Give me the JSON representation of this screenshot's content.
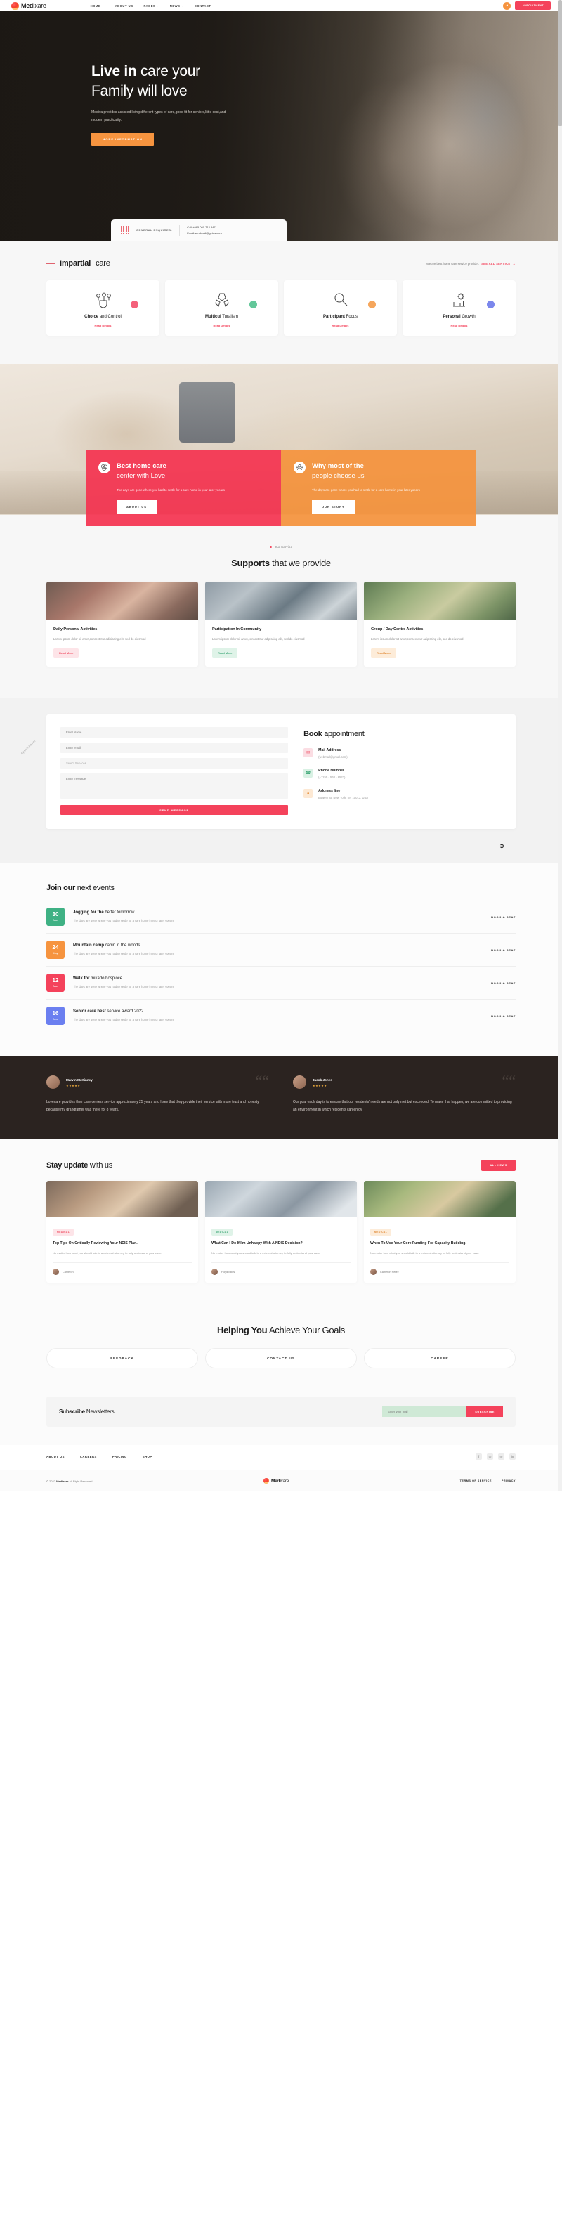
{
  "header": {
    "brand_bold": "Medi",
    "brand_light": "xare",
    "nav": [
      {
        "label": "HOME",
        "caret": "⌄"
      },
      {
        "label": "ABOUT US",
        "caret": ""
      },
      {
        "label": "PAGES",
        "caret": "⌄"
      },
      {
        "label": "NEWS",
        "caret": "⌄"
      },
      {
        "label": "CONTACT",
        "caret": ""
      }
    ],
    "avatar_icon": "user-icon",
    "appointment_label": "APPOINTMENT"
  },
  "hero": {
    "title_line1_bold": "Live in",
    "title_line1_rest": " care your",
    "title_line2": "Family will love",
    "paragraph": "Mediva provides assisted living,different types of care,good fit for seniors,little cost,and modern practicality.",
    "cta_label": "MORE INFORMATION",
    "contact": {
      "icon": "dot-grid-icon",
      "label": "GENERAL ENQUIRES:",
      "phone": "Call:+985 060 712 347",
      "email": "Email:sendmail@getus.com"
    }
  },
  "impartial": {
    "title_bold": "Impartial",
    "title_light": " care",
    "right_text": "We are best home care service provider.",
    "right_link": "SEE ALL SERVICE",
    "right_arrow": "→",
    "cards": [
      {
        "icon": "choice-control-icon",
        "title_bold": "Choice",
        "title_light": " and Control",
        "link": "Read Details",
        "blob": "#f4607a"
      },
      {
        "icon": "multiculturalism-icon",
        "title_bold": "Multicul",
        "title_light": " Turalism",
        "link": "Read Details",
        "blob": "#63c79a"
      },
      {
        "icon": "participant-focus-icon",
        "title_bold": "Participant",
        "title_light": " Focus",
        "link": "Read Details",
        "blob": "#f5a65c"
      },
      {
        "icon": "personal-growth-icon",
        "title_bold": "Personal",
        "title_light": " Growth",
        "link": "Read Details",
        "blob": "#7b87ec"
      }
    ]
  },
  "banners": [
    {
      "icon": "coins-icon",
      "title_bold": "Best home care",
      "title_light": "center with Love",
      "paragraph": "The days are gone where you had to settle for a care home in your later yoears",
      "cta": "ABOUT US",
      "color": "#f43451"
    },
    {
      "icon": "people-icon",
      "title_bold": "Why most of the",
      "title_light": "people choose us",
      "paragraph": "The days are gone where you had to settle for a care home in your later yoears",
      "cta": "OUR STORY",
      "color": "#f4943f"
    }
  ],
  "supports": {
    "eyebrow": "Our Service",
    "title_bold": "Supports",
    "title_light": " that we provide",
    "cards": [
      {
        "image": "group-dining-photo",
        "title": "Daily Personal Activities",
        "text": "Lorem ipsum dolor sit amet,consectetur adipiscing elit, sed do eiusmod",
        "pill": "Read More",
        "pill_style": "pink"
      },
      {
        "image": "community-photo",
        "title": "Participation In Community",
        "text": "Lorem ipsum dolor sit amet,consectetur adipiscing elit, sed do eiusmod",
        "pill": "Read More",
        "pill_style": "green"
      },
      {
        "image": "day-centre-photo",
        "title": "Group / Day Centre Activities",
        "text": "Lorem ipsum dolor sit amet,consectetur adipiscing elit, sed do eiusmod",
        "pill": "Read More",
        "pill_style": "orange"
      }
    ]
  },
  "book": {
    "vertical_label": "Appointment",
    "fields": [
      {
        "name": "name-field",
        "placeholder": "Enter Name"
      },
      {
        "name": "email-field",
        "placeholder": "Enter email"
      },
      {
        "name": "service-select",
        "placeholder": "Select Services",
        "caret": "⌄"
      },
      {
        "name": "message-field",
        "placeholder": "Enter message"
      }
    ],
    "submit_label": "SEND MESSAGE",
    "title_bold": "Book",
    "title_light": " appointment",
    "items": [
      {
        "icon": "mail-icon",
        "title": "Mail Address",
        "value": "(webmail@gmail.com)",
        "style": "pink"
      },
      {
        "icon": "phone-icon",
        "title": "Phone Number",
        "value": "(+1255 - 568 - 6523)",
        "style": "green"
      },
      {
        "icon": "location-icon",
        "title": "Address line",
        "value": "Bowery St, New York, NY 10013, USA",
        "style": "orange"
      }
    ]
  },
  "events": {
    "title_bold": "Join our",
    "title_light": " next events",
    "rows": [
      {
        "day": "30",
        "month": "Mar",
        "color": "ev-green",
        "title_bold": "Jogging for the",
        "title_light": " better tomorrow",
        "text": "The days are gone where you had to settle for a care home in your later yoears",
        "cta": "BOOK A SEAT"
      },
      {
        "day": "24",
        "month": "May",
        "color": "ev-orange",
        "title_bold": "Mountain camp",
        "title_light": " cabin in the woods",
        "text": "The days are gone where you had to settle for a care home in your later yoears",
        "cta": "BOOK A SEAT"
      },
      {
        "day": "12",
        "month": "Mar",
        "color": "ev-pink",
        "title_bold": "Walk for",
        "title_light": " mikado hospioce",
        "text": "The days are gone where you had to settle for a care home in your later yoears",
        "cta": "BOOK A SEAT"
      },
      {
        "day": "16",
        "month": "June",
        "color": "ev-blue",
        "title_bold": "Senior care best",
        "title_light": " service award 2022",
        "text": "The days are gone where you had to settle for a care home in your later yoears",
        "cta": "BOOK A SEAT"
      }
    ]
  },
  "testimonials": [
    {
      "avatar": "avatar-marvin",
      "name": "Marvin McKinney",
      "stars": "★★★★★",
      "quote_mark": "“",
      "text": "Lovecare provides their care centers service approximately 25 years and I see that they provide their service with more trust and honesty because my grandfather was there for 8 years."
    },
    {
      "avatar": "avatar-jacob",
      "name": "Jacob Jones",
      "stars": "★★★★★",
      "quote_mark": "“",
      "text": "Our goal each day is to ensure that our residents' needs are not only met but exceeded. To make that happen, we are committed to providing an environment in which residents can enjoy"
    }
  ],
  "blog": {
    "title_bold": "Stay update",
    "title_light": " with us",
    "all_label": "ALL NEWS",
    "cards": [
      {
        "image": "ndis-plan-photo",
        "tag": "MEDICAL",
        "tag_style": "pink",
        "title": "Top Tips On Critically Reviewing Your NDIS Plan.",
        "text": "No matter how what you should talk to a external attorney to fully understand your case.",
        "author_avatar": "avatar-cameron",
        "author": "Cameron"
      },
      {
        "image": "ndis-decision-photo",
        "tag": "MEDICAL",
        "tag_style": "green",
        "title": "What Can I Do If I'm Unhappy With A NDIS Decision?",
        "text": "No matter how what you should talk to a external attorney to fully understand your case.",
        "author_avatar": "avatar-floyd",
        "author": "Floyd Miles"
      },
      {
        "image": "capacity-building-photo",
        "tag": "MEDICAL",
        "tag_style": "orange",
        "title": "When To Use Your Core Funding For Capacity Building.",
        "text": "No matter how what you should talk to a external attorney to fully understand your case.",
        "author_avatar": "avatar-cameron2",
        "author": "Cameron Perez"
      }
    ]
  },
  "goals": {
    "title_bold": "Helping You",
    "title_light": " Achieve Your Goals",
    "buttons": [
      "FEEDBACK",
      "CONTACT US",
      "CAREER"
    ]
  },
  "subscribe": {
    "title_bold": "Subscribe",
    "title_light": " Newsletters",
    "placeholder": "Enter your mail",
    "button": "SUBSCRIBE"
  },
  "footer": {
    "links": [
      "ABOUT US",
      "CAREERS",
      "PRICING",
      "SHOP"
    ],
    "socials": [
      "facebook-icon",
      "twitter-icon",
      "instagram-icon",
      "linkedin-icon"
    ],
    "social_glyphs": [
      "f",
      "✉",
      "◎",
      "in"
    ],
    "copyright_prefix": "© 2022 ",
    "copyright_brand": "Medixare",
    "copyright_suffix": " All Right Reserved",
    "brand_bold": "Medi",
    "brand_light": "xare",
    "right_links": [
      "TERMS OF SERVICE",
      "PRIVACY"
    ]
  }
}
